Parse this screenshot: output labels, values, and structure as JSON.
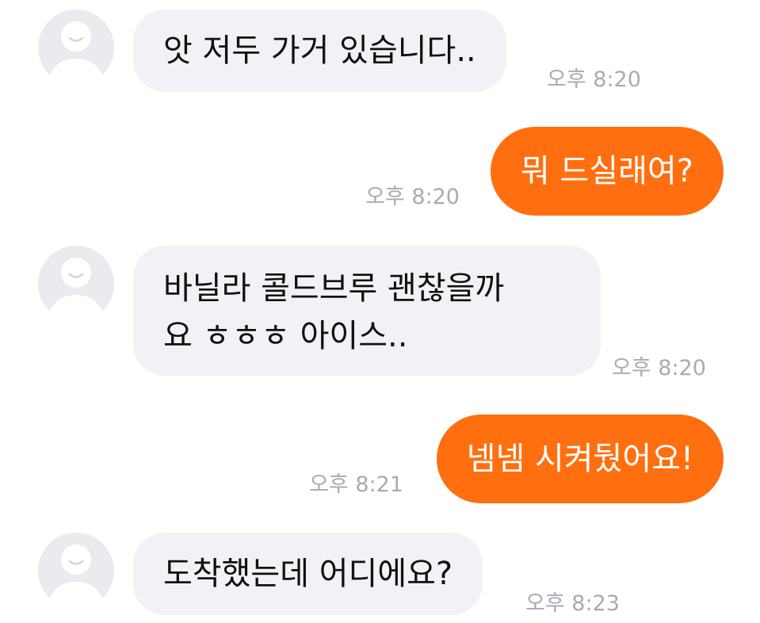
{
  "colors": {
    "incoming_bubble": "#f1f2f6",
    "outgoing_bubble": "#ff6f0f",
    "outgoing_text": "#ffffff",
    "timestamp": "#a7abb3",
    "avatar_bg": "#e9ebef"
  },
  "messages": [
    {
      "direction": "incoming",
      "avatar_icon": "default-profile-icon",
      "text": "앗 저두 가거 있습니다..",
      "time": "오후 8:20"
    },
    {
      "direction": "outgoing",
      "text": "뭐 드실래여?",
      "time": "오후 8:20"
    },
    {
      "direction": "incoming",
      "avatar_icon": "default-profile-icon",
      "line1": "바닐라 콜드브루 괜찮을까",
      "line2": "요 ㅎㅎㅎ 아이스..",
      "time": "오후 8:20"
    },
    {
      "direction": "outgoing",
      "text": "넴넴 시켜뒀어요!",
      "time": "오후 8:21"
    },
    {
      "direction": "incoming",
      "avatar_icon": "default-profile-icon",
      "text": "도착했는데 어디에요?",
      "time": "오후 8:23"
    }
  ]
}
